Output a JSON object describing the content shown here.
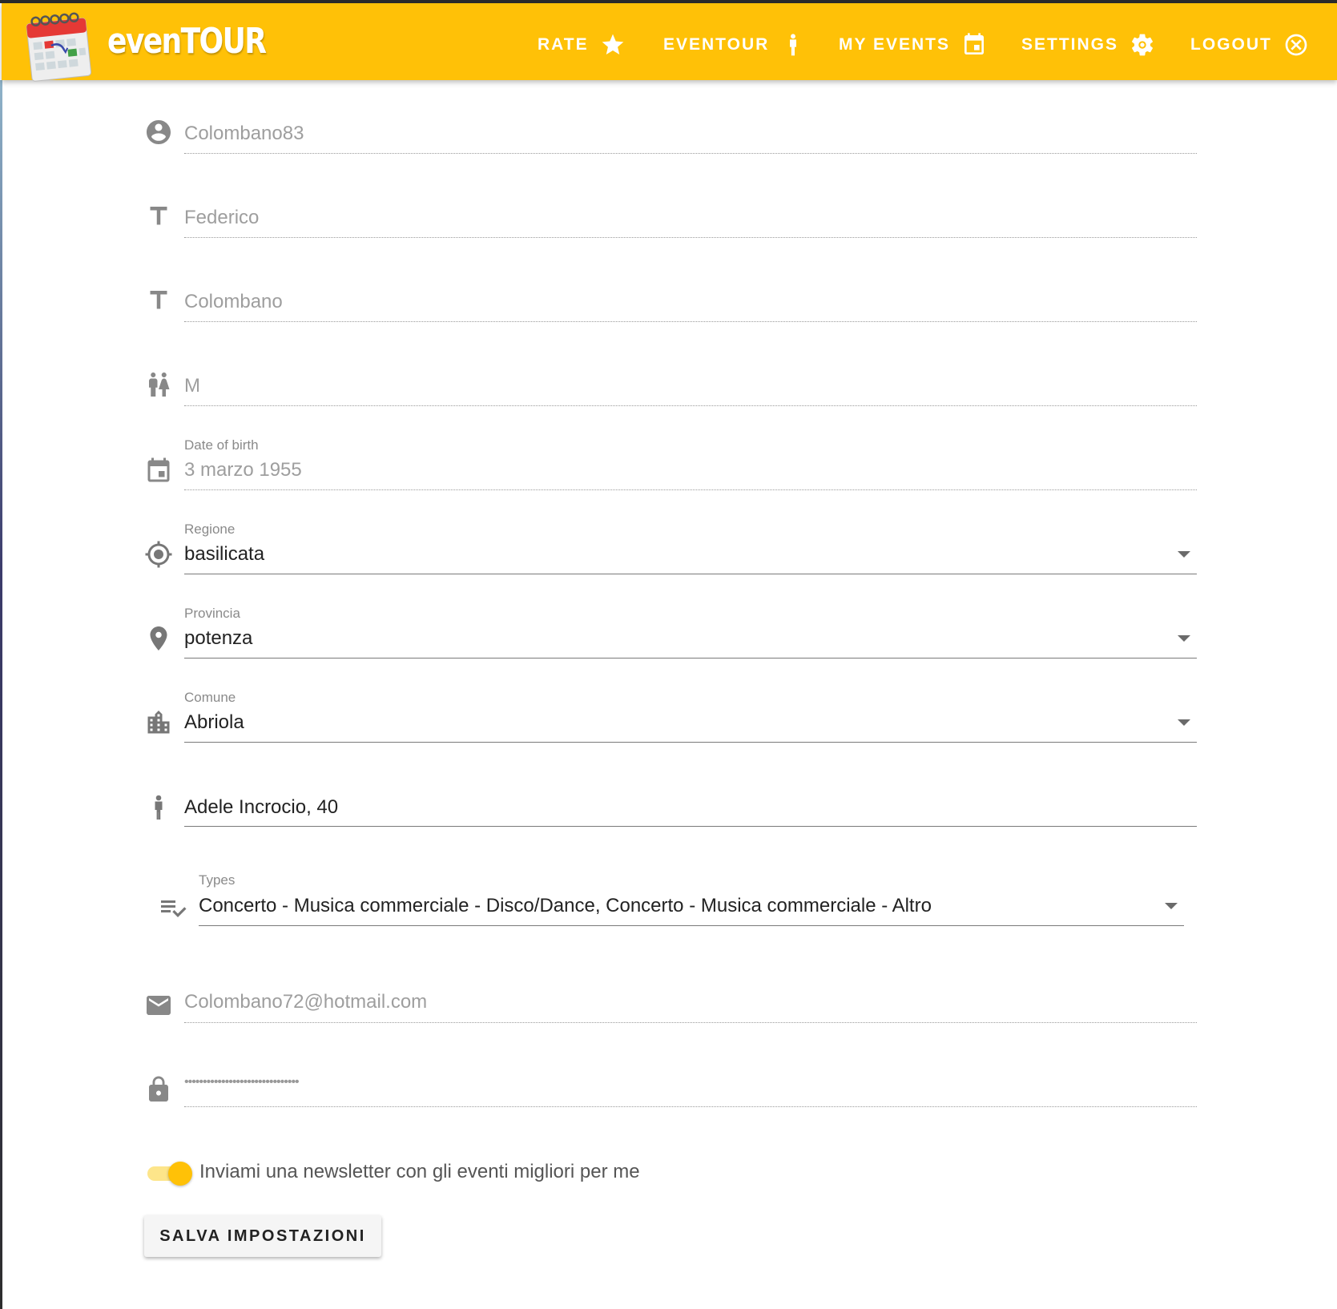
{
  "app": {
    "brand": "evenTOUR",
    "accent_color": "#ffc107",
    "logo_icon": "calendar-logo-icon"
  },
  "nav": {
    "items": [
      {
        "label": "RATE",
        "icon": "star-icon"
      },
      {
        "label": "EVENTOUR",
        "icon": "person-icon"
      },
      {
        "label": "MY EVENTS",
        "icon": "calendar-icon"
      },
      {
        "label": "SETTINGS",
        "icon": "gear-icon"
      },
      {
        "label": "LOGOUT",
        "icon": "close-circle-icon"
      }
    ]
  },
  "form": {
    "username": {
      "value": "Colombano83",
      "icon": "account-circle-icon"
    },
    "first_name": {
      "value": "Federico",
      "icon": "text-icon"
    },
    "last_name": {
      "value": "Colombano",
      "icon": "text-icon"
    },
    "gender": {
      "value": "M",
      "icon": "wc-icon"
    },
    "birth_date": {
      "label": "Date of birth",
      "value": "3 marzo 1955",
      "icon": "calendar-icon"
    },
    "regione": {
      "label": "Regione",
      "value": "basilicata",
      "icon": "gps-icon"
    },
    "provincia": {
      "label": "Provincia",
      "value": "potenza",
      "icon": "location-pin-icon"
    },
    "comune": {
      "label": "Comune",
      "value": "Abriola",
      "icon": "city-icon"
    },
    "address": {
      "value": "Adele Incrocio, 40",
      "icon": "person-icon"
    },
    "types": {
      "label": "Types",
      "value": "Concerto - Musica commerciale - Disco/Dance, Concerto - Musica commerciale - Altro",
      "icon": "playlist-check-icon"
    },
    "email": {
      "value": "Colombano72@hotmail.com",
      "icon": "mail-icon"
    },
    "password": {
      "value": "•••••••••••••••••••••••••••••••",
      "icon": "lock-icon"
    },
    "newsletter": {
      "label": "Inviami una newsletter con gli eventi migliori per me",
      "enabled": true
    },
    "save_label": "SALVA IMPOSTAZIONI"
  }
}
